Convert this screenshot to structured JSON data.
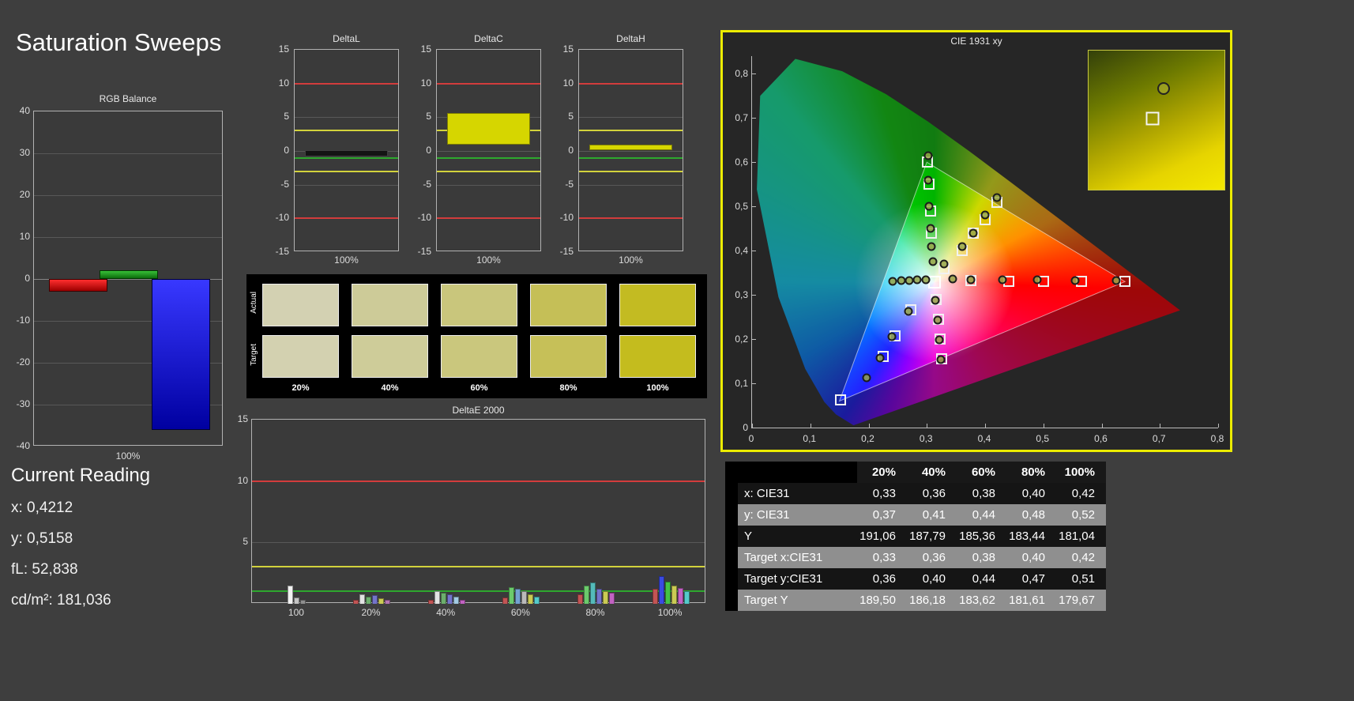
{
  "app": {
    "title": "Saturation Sweeps"
  },
  "current_reading": {
    "title": "Current Reading",
    "lines": [
      "x: 0,4212",
      "y: 0,5158",
      "fL: 52,838",
      "cd/m²: 181,036"
    ]
  },
  "rgb_balance": {
    "title": "RGB Balance",
    "xlabel": "100%",
    "ylim": [
      -40,
      40
    ],
    "y_ticks": [
      "40",
      "30",
      "20",
      "10",
      "0",
      "-10",
      "-20",
      "-30",
      "-40"
    ],
    "bars": [
      {
        "name": "red",
        "value": -3,
        "color_start": "#ff2e2e",
        "color_end": "#9c0000",
        "border": "#3a0000"
      },
      {
        "name": "green",
        "value": 2,
        "color_start": "#38c038",
        "color_end": "#0c6c0c",
        "border": "#003600"
      },
      {
        "name": "blue",
        "value": -36,
        "color_start": "#3838ff",
        "color_end": "#0000a0",
        "border": "#000036"
      }
    ]
  },
  "delta_limit_lines": [
    {
      "value": 10,
      "color": "#d23c3c"
    },
    {
      "value": -10,
      "color": "#d23c3c"
    },
    {
      "value": 3,
      "color": "#d2d23c"
    },
    {
      "value": -3,
      "color": "#d2d23c"
    },
    {
      "value": -1,
      "color": "#2ea82e"
    }
  ],
  "delta_charts": [
    {
      "title": "DeltaL",
      "xlabel": "100%",
      "ylim": [
        -15,
        15
      ],
      "y_ticks": [
        "15",
        "10",
        "5",
        "0",
        "-5",
        "-10",
        "-15"
      ],
      "bar": {
        "from": 0.15,
        "to": -0.8,
        "color": "#141414",
        "border": "#404040"
      }
    },
    {
      "title": "DeltaC",
      "xlabel": "100%",
      "ylim": [
        -15,
        15
      ],
      "y_ticks": [
        "15",
        "10",
        "5",
        "0",
        "-5",
        "-10",
        "-15"
      ],
      "bar": {
        "from": 5.6,
        "to": 0.9,
        "color": "#d6d600",
        "border": "#7c7c00"
      }
    },
    {
      "title": "DeltaH",
      "xlabel": "100%",
      "ylim": [
        -15,
        15
      ],
      "y_ticks": [
        "15",
        "10",
        "5",
        "0",
        "-5",
        "-10",
        "-15"
      ],
      "bar": {
        "from": 0.9,
        "to": 0.15,
        "color": "#d6d600",
        "border": "#7c7c00"
      }
    }
  ],
  "swatches": {
    "row_labels": [
      "Actual",
      "Target"
    ],
    "col_labels": [
      "20%",
      "40%",
      "60%",
      "80%",
      "100%"
    ],
    "actual_colors": [
      "#d3d1b2",
      "#cdcb98",
      "#c9c67c",
      "#c5bf57",
      "#c3bb22"
    ],
    "target_colors": [
      "#d3d1b0",
      "#cecc99",
      "#cac77d",
      "#c6c058",
      "#c4bc1e"
    ]
  },
  "deltae": {
    "title": "DeltaE 2000",
    "ylim": [
      0,
      15
    ],
    "y_ticks": [
      "15",
      "10",
      "5"
    ],
    "limit_lines": [
      {
        "value": 10,
        "color": "#d23c3c"
      },
      {
        "value": 3,
        "color": "#d2d23c"
      },
      {
        "value": 1,
        "color": "#2ea82e"
      }
    ],
    "groups": [
      {
        "label": "100",
        "bars": [
          {
            "color": "#f2f2f2",
            "value": 1.5
          },
          {
            "color": "#c4c4c4",
            "value": 0.5
          },
          {
            "color": "#8e8e8e",
            "value": 0.35
          }
        ]
      },
      {
        "label": "20%",
        "bars": [
          {
            "color": "#c25454",
            "value": 0.35
          },
          {
            "color": "#e2e2e2",
            "value": 0.8
          },
          {
            "color": "#6cae6c",
            "value": 0.55
          },
          {
            "color": "#7474ca",
            "value": 0.7
          },
          {
            "color": "#caca54",
            "value": 0.45
          },
          {
            "color": "#b274b2",
            "value": 0.3
          }
        ]
      },
      {
        "label": "40%",
        "bars": [
          {
            "color": "#c25454",
            "value": 0.3
          },
          {
            "color": "#e2e2e2",
            "value": 1.05
          },
          {
            "color": "#6cae6c",
            "value": 0.9
          },
          {
            "color": "#7474ca",
            "value": 0.75
          },
          {
            "color": "#a2cae2",
            "value": 0.6
          },
          {
            "color": "#c262c2",
            "value": 0.35
          }
        ]
      },
      {
        "label": "60%",
        "bars": [
          {
            "color": "#c25454",
            "value": 0.5
          },
          {
            "color": "#6cca6c",
            "value": 1.35
          },
          {
            "color": "#74a2d2",
            "value": 1.2
          },
          {
            "color": "#bababa",
            "value": 1.0
          },
          {
            "color": "#caca54",
            "value": 0.8
          },
          {
            "color": "#54caca",
            "value": 0.6
          }
        ]
      },
      {
        "label": "80%",
        "bars": [
          {
            "color": "#c25454",
            "value": 0.8
          },
          {
            "color": "#6cca6c",
            "value": 1.5
          },
          {
            "color": "#54baba",
            "value": 1.75
          },
          {
            "color": "#7474ca",
            "value": 1.2
          },
          {
            "color": "#caca54",
            "value": 1.05
          },
          {
            "color": "#c262c2",
            "value": 0.9
          }
        ]
      },
      {
        "label": "100%",
        "bars": [
          {
            "color": "#c25454",
            "value": 1.2
          },
          {
            "color": "#3a4ae2",
            "value": 2.25
          },
          {
            "color": "#44c244",
            "value": 1.8
          },
          {
            "color": "#caca54",
            "value": 1.45
          },
          {
            "color": "#c262c2",
            "value": 1.3
          },
          {
            "color": "#54caca",
            "value": 1.05
          }
        ]
      }
    ]
  },
  "cie": {
    "title": "CIE 1931 xy",
    "xlim": [
      0,
      0.8
    ],
    "ylim_top": 0.84,
    "x_tick_labels": [
      "0",
      "0,1",
      "0,2",
      "0,3",
      "0,4",
      "0,5",
      "0,6",
      "0,7",
      "0,8"
    ],
    "y_tick_labels": [
      "0,8",
      "0,7",
      "0,6",
      "0,5",
      "0,4",
      "0,3",
      "0,2",
      "0,1",
      "0"
    ],
    "locus": [
      [
        0.1741,
        0.005
      ],
      [
        0.144,
        0.0297
      ],
      [
        0.1241,
        0.0578
      ],
      [
        0.0913,
        0.1327
      ],
      [
        0.0454,
        0.295
      ],
      [
        0.0082,
        0.5384
      ],
      [
        0.0139,
        0.7502
      ],
      [
        0.0743,
        0.8338
      ],
      [
        0.1547,
        0.8059
      ],
      [
        0.2296,
        0.7543
      ],
      [
        0.3016,
        0.6923
      ],
      [
        0.3731,
        0.6245
      ],
      [
        0.4441,
        0.5547
      ],
      [
        0.5125,
        0.4866
      ],
      [
        0.5752,
        0.4242
      ],
      [
        0.627,
        0.3725
      ],
      [
        0.6658,
        0.334
      ],
      [
        0.6915,
        0.3083
      ],
      [
        0.7079,
        0.292
      ],
      [
        0.7347,
        0.2653
      ]
    ],
    "srgb_triangle": [
      [
        0.64,
        0.33
      ],
      [
        0.3,
        0.6
      ],
      [
        0.15,
        0.06
      ]
    ],
    "white_point": [
      0.313,
      0.329
    ],
    "measured_points": [
      [
        0.33,
        0.37
      ],
      [
        0.36,
        0.41
      ],
      [
        0.38,
        0.44
      ],
      [
        0.4,
        0.48
      ],
      [
        0.42,
        0.52
      ],
      [
        0.311,
        0.375
      ],
      [
        0.308,
        0.41
      ],
      [
        0.306,
        0.45
      ],
      [
        0.304,
        0.5
      ],
      [
        0.303,
        0.56
      ],
      [
        0.302,
        0.615
      ],
      [
        0.345,
        0.336
      ],
      [
        0.375,
        0.335
      ],
      [
        0.43,
        0.335
      ],
      [
        0.49,
        0.334
      ],
      [
        0.555,
        0.333
      ],
      [
        0.625,
        0.333
      ],
      [
        0.298,
        0.334
      ],
      [
        0.284,
        0.334
      ],
      [
        0.27,
        0.333
      ],
      [
        0.256,
        0.332
      ],
      [
        0.242,
        0.331
      ],
      [
        0.268,
        0.263
      ],
      [
        0.24,
        0.205
      ],
      [
        0.22,
        0.158
      ],
      [
        0.196,
        0.112
      ],
      [
        0.315,
        0.287
      ],
      [
        0.318,
        0.243
      ],
      [
        0.321,
        0.198
      ],
      [
        0.324,
        0.153
      ]
    ],
    "target_points": [
      [
        0.33,
        0.36
      ],
      [
        0.36,
        0.4
      ],
      [
        0.38,
        0.44
      ],
      [
        0.4,
        0.47
      ],
      [
        0.42,
        0.51
      ],
      [
        0.308,
        0.44
      ],
      [
        0.306,
        0.49
      ],
      [
        0.304,
        0.55
      ],
      [
        0.301,
        0.6
      ],
      [
        0.375,
        0.332
      ],
      [
        0.44,
        0.331
      ],
      [
        0.5,
        0.331
      ],
      [
        0.565,
        0.33
      ],
      [
        0.64,
        0.33
      ],
      [
        0.272,
        0.266
      ],
      [
        0.246,
        0.208
      ],
      [
        0.225,
        0.16
      ],
      [
        0.152,
        0.062
      ],
      [
        0.316,
        0.29
      ],
      [
        0.32,
        0.245
      ],
      [
        0.323,
        0.2
      ],
      [
        0.326,
        0.155
      ]
    ],
    "inset": {
      "circle": [
        0.55,
        0.27
      ],
      "square": [
        0.47,
        0.49
      ]
    }
  },
  "table": {
    "col_headers": [
      "20%",
      "40%",
      "60%",
      "80%",
      "100%"
    ],
    "rows": [
      {
        "label": "x: CIE31",
        "values": [
          "0,33",
          "0,36",
          "0,38",
          "0,40",
          "0,42"
        ]
      },
      {
        "label": "y: CIE31",
        "values": [
          "0,37",
          "0,41",
          "0,44",
          "0,48",
          "0,52"
        ]
      },
      {
        "label": "Y",
        "values": [
          "191,06",
          "187,79",
          "185,36",
          "183,44",
          "181,04"
        ]
      },
      {
        "label": "Target x:CIE31",
        "values": [
          "0,33",
          "0,36",
          "0,38",
          "0,40",
          "0,42"
        ]
      },
      {
        "label": "Target y:CIE31",
        "values": [
          "0,36",
          "0,40",
          "0,44",
          "0,47",
          "0,51"
        ]
      },
      {
        "label": "Target Y",
        "values": [
          "189,50",
          "186,18",
          "183,62",
          "181,61",
          "179,67"
        ]
      }
    ]
  },
  "colors": {
    "selection_border": "#ecec00",
    "background": "#3e3e3e",
    "panel_black": "#000000"
  }
}
